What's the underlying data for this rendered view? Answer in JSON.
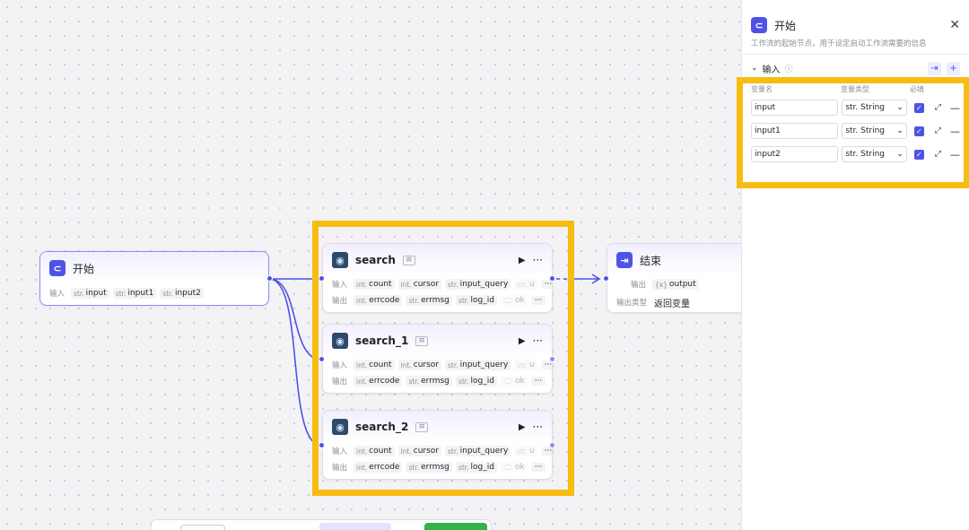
{
  "colors": {
    "accent": "#4d53e8",
    "highlight": "#f7bc12",
    "run_green": "#2fb34a"
  },
  "start_node": {
    "title": "开始",
    "icon": "start-icon",
    "input_label": "输入",
    "inputs": [
      {
        "type": "str.",
        "name": "input"
      },
      {
        "type": "str.",
        "name": "input1"
      },
      {
        "type": "str.",
        "name": "input2"
      }
    ]
  },
  "search_nodes": [
    {
      "title": "search",
      "in_label": "输入",
      "out_label": "输出",
      "inputs": [
        {
          "type": "int.",
          "name": "count"
        },
        {
          "type": "int.",
          "name": "cursor"
        },
        {
          "type": "str.",
          "name": "input_query"
        },
        {
          "type": "str.",
          "name": "u"
        }
      ],
      "outputs": [
        {
          "type": "int.",
          "name": "errcode"
        },
        {
          "type": "str.",
          "name": "errmsg"
        },
        {
          "type": "str.",
          "name": "log_id"
        },
        {
          "type": "",
          "name": "ok"
        }
      ]
    },
    {
      "title": "search_1",
      "in_label": "输入",
      "out_label": "输出",
      "inputs": [
        {
          "type": "int.",
          "name": "count"
        },
        {
          "type": "int.",
          "name": "cursor"
        },
        {
          "type": "str.",
          "name": "input_query"
        },
        {
          "type": "str.",
          "name": "u"
        }
      ],
      "outputs": [
        {
          "type": "int.",
          "name": "errcode"
        },
        {
          "type": "str.",
          "name": "errmsg"
        },
        {
          "type": "str.",
          "name": "log_id"
        },
        {
          "type": "",
          "name": "ok"
        }
      ]
    },
    {
      "title": "search_2",
      "in_label": "输入",
      "out_label": "输出",
      "inputs": [
        {
          "type": "int.",
          "name": "count"
        },
        {
          "type": "int.",
          "name": "cursor"
        },
        {
          "type": "str.",
          "name": "input_query"
        },
        {
          "type": "str.",
          "name": "u"
        }
      ],
      "outputs": [
        {
          "type": "int.",
          "name": "errcode"
        },
        {
          "type": "str.",
          "name": "errmsg"
        },
        {
          "type": "str.",
          "name": "log_id"
        },
        {
          "type": "",
          "name": "ok"
        }
      ]
    }
  ],
  "more_label": "···",
  "end_node": {
    "title": "结束",
    "output_label": "输出",
    "output_type": "{x}",
    "output_name": "output",
    "output_kind_label": "输出类型",
    "output_kind_value": "返回变量"
  },
  "panel": {
    "title": "开始",
    "description": "工作流的起始节点，用于设定启动工作流需要的信息",
    "section_label": "输入",
    "columns": {
      "name": "变量名",
      "type": "变量类型",
      "required": "必填"
    },
    "variables": [
      {
        "name": "input",
        "type": "str. String",
        "required": true
      },
      {
        "name": "input1",
        "type": "str. String",
        "required": true
      },
      {
        "name": "input2",
        "type": "str. String",
        "required": true
      }
    ]
  }
}
